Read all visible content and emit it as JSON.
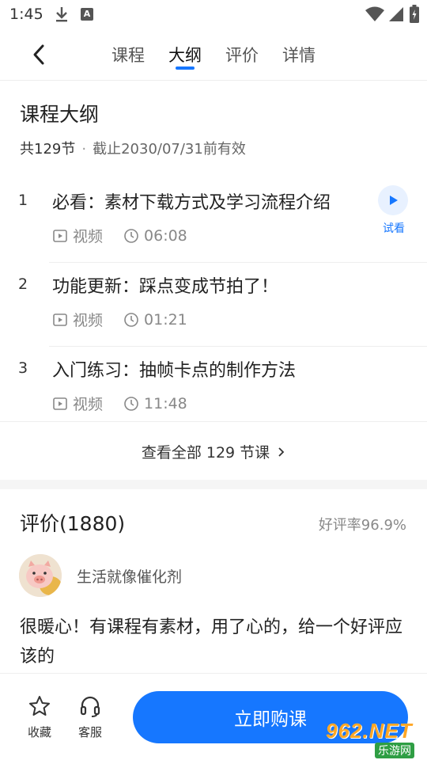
{
  "status_bar": {
    "time": "1:45",
    "notification_letter": "A"
  },
  "nav": {
    "tabs": [
      {
        "label": "课程",
        "active": false
      },
      {
        "label": "大纲",
        "active": true
      },
      {
        "label": "评价",
        "active": false
      },
      {
        "label": "详情",
        "active": false
      }
    ]
  },
  "outline": {
    "title": "课程大纲",
    "lesson_count": "共129节",
    "separator": "·",
    "expiry": "截止2030/07/31前有效",
    "lessons": [
      {
        "number": "1",
        "title": "必看：素材下载方式及学习流程介绍",
        "type": "视频",
        "duration": "06:08",
        "trial_label": "试看"
      },
      {
        "number": "2",
        "title": "功能更新：踩点变成节拍了！",
        "type": "视频",
        "duration": "01:21"
      },
      {
        "number": "3",
        "title": "入门练习：抽帧卡点的制作方法",
        "type": "视频",
        "duration": "11:48"
      }
    ],
    "view_all": "查看全部 129 节课"
  },
  "reviews": {
    "title": "评价(1880)",
    "good_rate": "好评率96.9%",
    "items": [
      {
        "reviewer": "生活就像催化剂",
        "text": "很暖心！有课程有素材，用了心的，给一个好评应该的"
      }
    ]
  },
  "bottom_bar": {
    "favorite_label": "收藏",
    "service_label": "客服",
    "buy_label": "立即购课"
  },
  "watermark": {
    "main": "962.NET",
    "sub": "乐游网"
  },
  "colors": {
    "accent": "#1677ff",
    "trial_bg": "#e8f1ff",
    "divider": "#eeeeee"
  }
}
